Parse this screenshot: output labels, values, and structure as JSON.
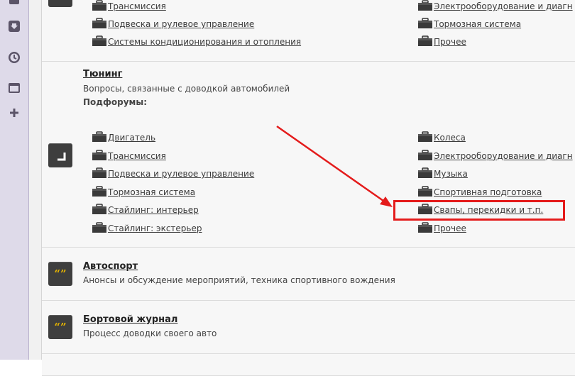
{
  "group1": {
    "left": [
      "Трансмиссия",
      "Подвеска и рулевое управление",
      "Системы кондиционирования и отопления"
    ],
    "right": [
      "Электрооборудование и диагн",
      "Тормозная система",
      "Прочее"
    ]
  },
  "tuning": {
    "title": "Тюнинг",
    "description": "Вопросы, связанные с доводкой автомобилей",
    "subforums_label": "Подфорумы:",
    "left": [
      "Двигатель",
      "Трансмиссия",
      "Подвеска и рулевое управление",
      "Тормозная система",
      "Стайлинг: интерьер",
      "Стайлинг: экстерьер"
    ],
    "right": [
      "Колеса",
      "Электрооборудование и диагн",
      "Музыка",
      "Спортивная подготовка",
      "Свапы, перекидки и т.п.",
      "Прочее"
    ]
  },
  "autosport": {
    "title": "Автоспорт",
    "description": "Анонсы и обсуждение мероприятий, техника спортивного вождения",
    "icon_text": "“”"
  },
  "logbook": {
    "title": "Бортовой журнал",
    "description": "Процесс доводки своего авто",
    "icon_text": "“”"
  },
  "colors": {
    "annotation": "#e41b1b",
    "sidebar": "#dedae9",
    "quote_icon": "#e6b400"
  }
}
